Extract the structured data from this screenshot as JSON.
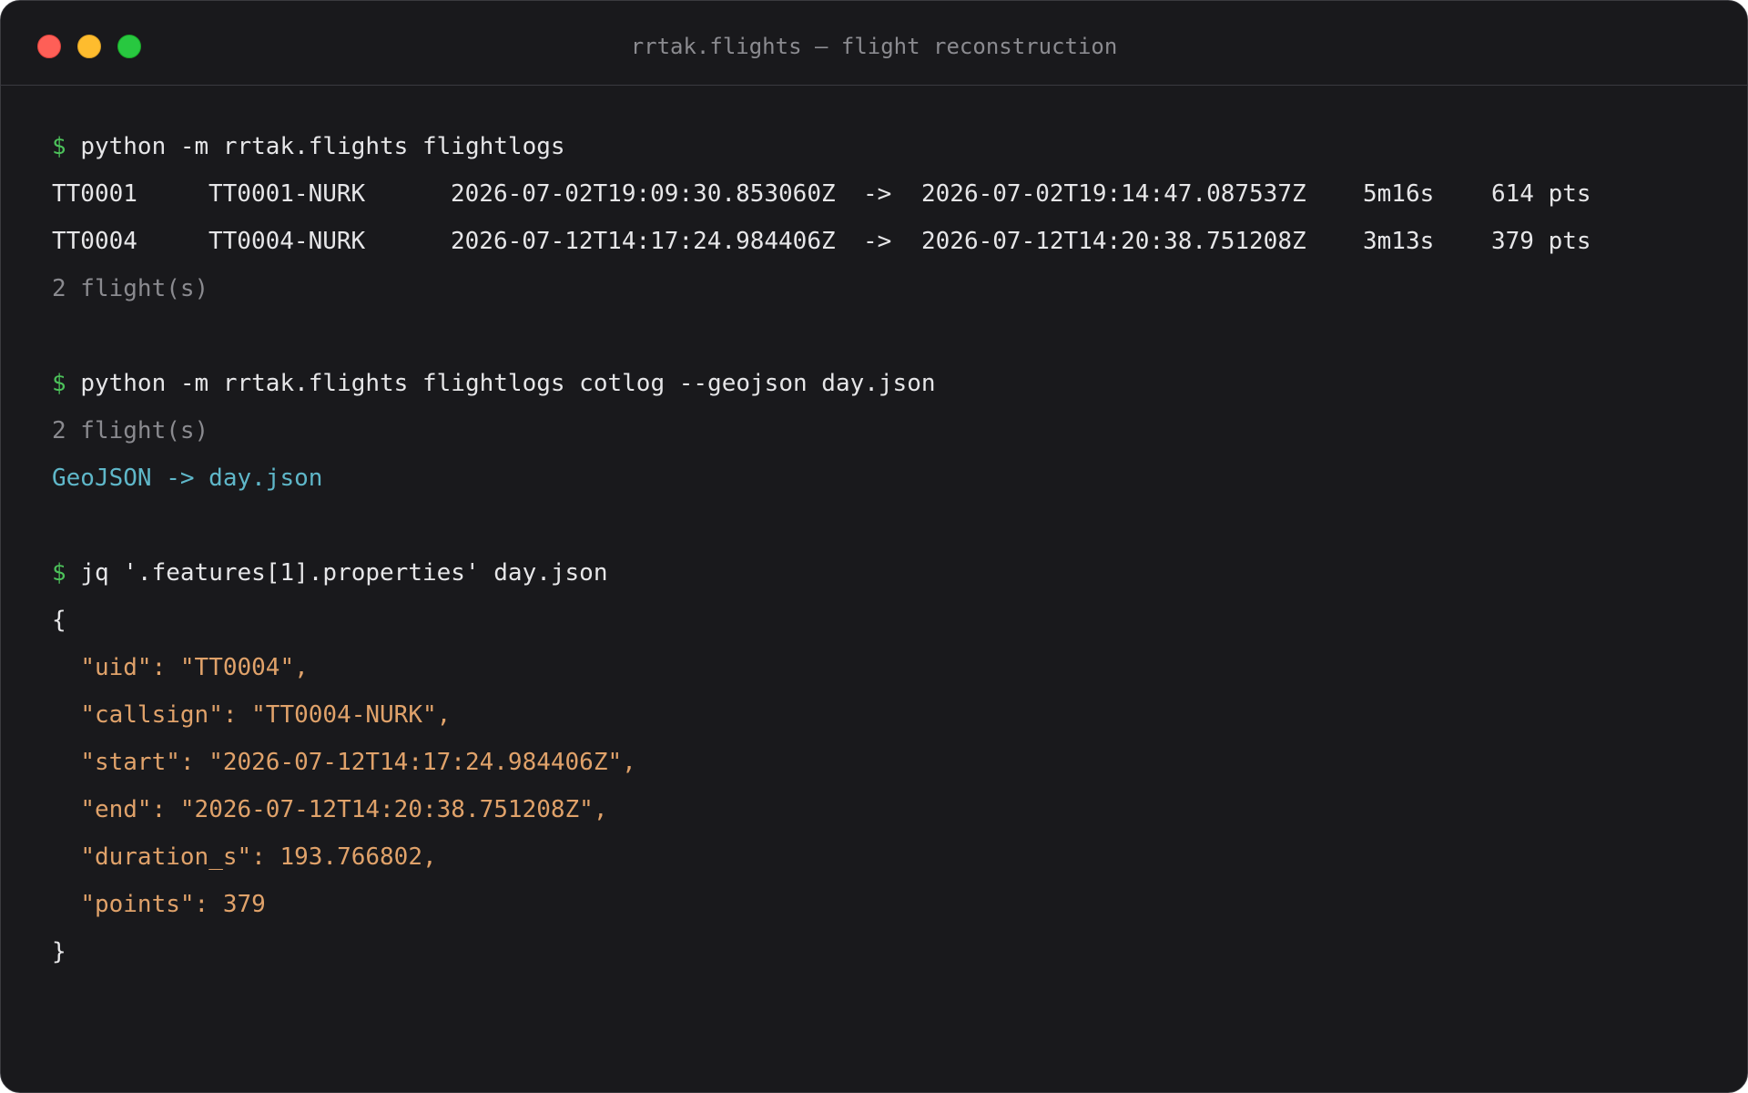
{
  "window": {
    "title": "rrtak.flights — flight reconstruction"
  },
  "commands": {
    "prompt": "$",
    "cmd1": "python -m rrtak.flights flightlogs",
    "cmd2": "python -m rrtak.flights flightlogs cotlog --geojson day.json",
    "cmd3": "jq '.features[1].properties' day.json"
  },
  "flights_table": {
    "arrow": "->",
    "rows": [
      {
        "uid": "TT0001",
        "callsign": "TT0001-NURK",
        "start": "2026-07-02T19:09:30.853060Z",
        "end": "2026-07-02T19:14:47.087537Z",
        "duration": "5m16s",
        "points": "614 pts"
      },
      {
        "uid": "TT0004",
        "callsign": "TT0004-NURK",
        "start": "2026-07-12T14:17:24.984406Z",
        "end": "2026-07-12T14:20:38.751208Z",
        "duration": "3m13s",
        "points": "379 pts"
      }
    ]
  },
  "output": {
    "count1": "2 flight(s)",
    "count2": "2 flight(s)",
    "geojson_line": "GeoJSON -> day.json"
  },
  "json_output": {
    "open_brace": "{",
    "lines": [
      "\"uid\": \"TT0004\",",
      "\"callsign\": \"TT0004-NURK\",",
      "\"start\": \"2026-07-12T14:17:24.984406Z\",",
      "\"end\": \"2026-07-12T14:20:38.751208Z\",",
      "\"duration_s\": 193.766802,",
      "\"points\": 379"
    ],
    "close_brace": "}"
  },
  "colors": {
    "background": "#19191c",
    "prompt": "#4cc15a",
    "muted": "#8a8a8f",
    "cyan": "#5fb7c9",
    "json_value": "#e0a26a"
  }
}
